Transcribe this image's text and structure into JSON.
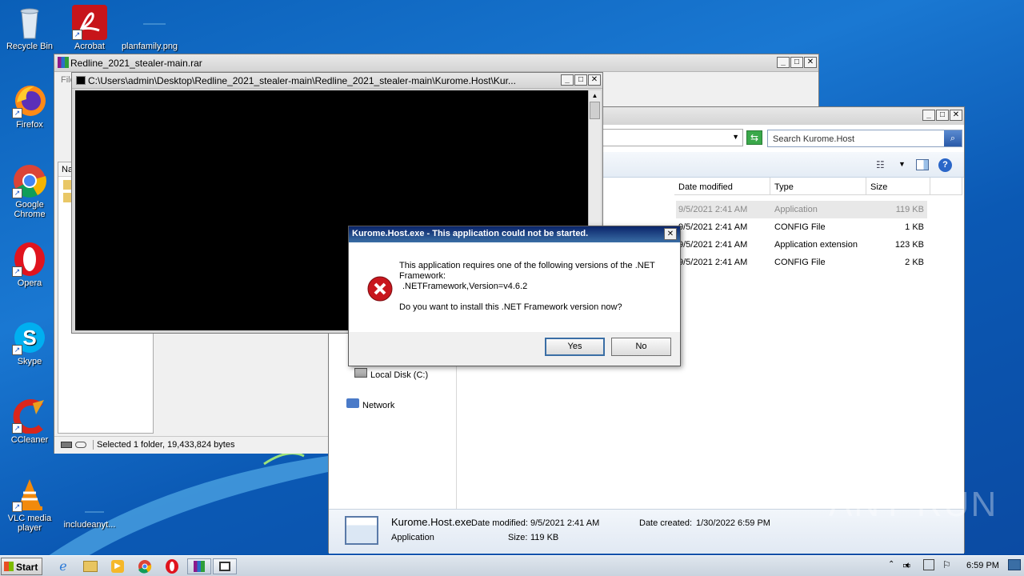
{
  "desktop": {
    "icons": [
      {
        "label": "Recycle Bin"
      },
      {
        "label": "Acrobat"
      },
      {
        "label": "planfamily.png"
      },
      {
        "label": "Firefox"
      },
      {
        "label": "Google Chrome"
      },
      {
        "label": "Opera"
      },
      {
        "label": "Skype"
      },
      {
        "label": "CCleaner"
      },
      {
        "label": "VLC media player"
      },
      {
        "label": "includeanyt..."
      }
    ]
  },
  "winrar": {
    "title": "Redline_2021_stealer-main.rar",
    "menu_fragment": "File",
    "col_fragment": "Na",
    "status": "Selected 1 folder, 19,433,824 bytes"
  },
  "console": {
    "title": "C:\\Users\\admin\\Desktop\\Redline_2021_stealer-main\\Redline_2021_stealer-main\\Kurome.Host\\Kur..."
  },
  "explorer": {
    "search_placeholder": "Search Kurome.Host",
    "columns": [
      "Date modified",
      "Type",
      "Size"
    ],
    "rows": [
      {
        "date": "9/5/2021 2:41 AM",
        "type": "Application",
        "size": "119 KB"
      },
      {
        "date": "9/5/2021 2:41 AM",
        "type": "CONFIG File",
        "size": "1 KB"
      },
      {
        "date": "9/5/2021 2:41 AM",
        "type": "Application extension",
        "size": "123 KB"
      },
      {
        "date": "9/5/2021 2:41 AM",
        "type": "CONFIG File",
        "size": "2 KB"
      }
    ],
    "nav": {
      "local_disk": "Local Disk (C:)",
      "network": "Network"
    },
    "details": {
      "name": "Kurome.Host.exe",
      "kind": "Application",
      "date_modified_label": "Date modified:",
      "date_modified": "9/5/2021 2:41 AM",
      "size_label": "Size:",
      "size": "119 KB",
      "date_created_label": "Date created:",
      "date_created": "1/30/2022 6:59 PM"
    }
  },
  "dialog": {
    "title": "Kurome.Host.exe - This application could not be started.",
    "line1": "This application requires one of the following versions of the .NET",
    "line2": "Framework:",
    "line3": ".NETFramework,Version=v4.6.2",
    "line4": "Do you want to install this .NET Framework version now?",
    "yes": "Yes",
    "no": "No"
  },
  "taskbar": {
    "start": "Start",
    "clock": "6:59 PM"
  },
  "watermark": "ANY RUN",
  "colors": {
    "error_red": "#c8161d",
    "desktop_blue": "#1a78d2",
    "dialog_title": "#0a246a"
  }
}
